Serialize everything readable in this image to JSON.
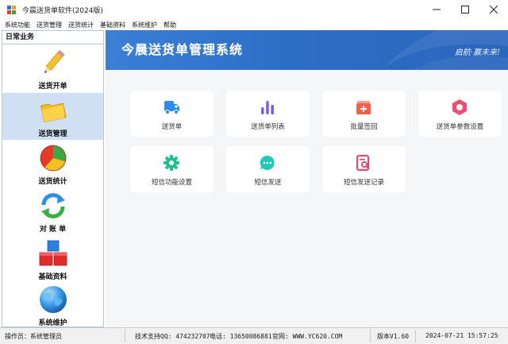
{
  "window": {
    "title": "今晨送货单软件(2024版)"
  },
  "menu": [
    "系统功能",
    "送货管理",
    "送货统计",
    "基础资料",
    "系统维护",
    "帮助"
  ],
  "sidebar": {
    "header": "日常业务",
    "items": [
      {
        "label": "送货开单",
        "icon": "pencil-icon"
      },
      {
        "label": "送货管理",
        "icon": "folder-icon",
        "active": true
      },
      {
        "label": "送货统计",
        "icon": "pie-cube-icon"
      },
      {
        "label": "对 账 单",
        "icon": "refresh-icon"
      },
      {
        "label": "基础资料",
        "icon": "blocks-icon"
      },
      {
        "label": "系统维护",
        "icon": "globe-icon"
      }
    ]
  },
  "banner": {
    "title": "今晨送货单管理系统",
    "slogan": "启航·赢未来!"
  },
  "cards": [
    {
      "label": "送货单",
      "icon": "truck-icon",
      "color": "#2e8bf0"
    },
    {
      "label": "送货单列表",
      "icon": "bar-chart-icon",
      "color": "#7b5cf0"
    },
    {
      "label": "批量签回",
      "icon": "add-box-icon",
      "color": "#f0604d"
    },
    {
      "label": "送货单参数设置",
      "icon": "hexagon-nut-icon",
      "color": "#ee4d77"
    },
    {
      "label": "短信功能设置",
      "icon": "gear-icon",
      "color": "#1fbf8f"
    },
    {
      "label": "短信发送",
      "icon": "chat-bubble-icon",
      "color": "#22c7b8"
    },
    {
      "label": "短信发送记录",
      "icon": "document-search-icon",
      "color": "#f0416d"
    }
  ],
  "status": {
    "operator": "操作员：系统管理员",
    "support": "技术支持QQ: 474232707",
    "phone": "电话: 13650086881",
    "website": "官网: WWW.YC620.COM",
    "version": "版本V1.60",
    "datetime": "2024-07-21 15:57:25"
  }
}
